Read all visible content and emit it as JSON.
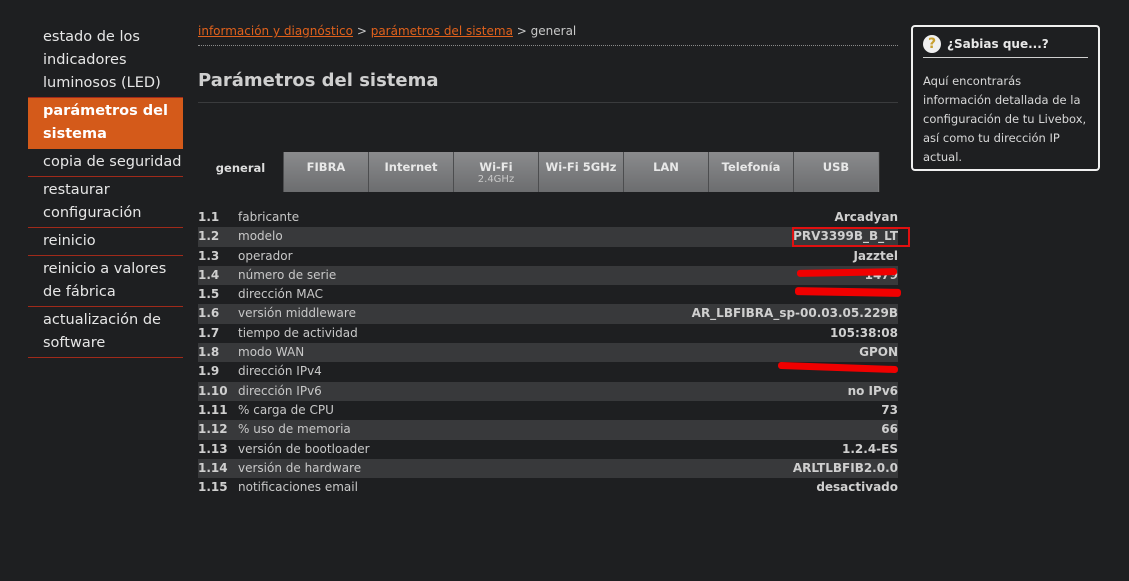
{
  "sidebar": {
    "items": [
      {
        "label": "estado de los indicadores luminosos (LED)",
        "active": false
      },
      {
        "label": "parámetros del sistema",
        "active": true
      },
      {
        "label": "copia de seguridad",
        "active": false
      },
      {
        "label": "restaurar configuración",
        "active": false
      },
      {
        "label": "reinicio",
        "active": false
      },
      {
        "label": "reinicio a valores de fábrica",
        "active": false
      },
      {
        "label": "actualización de software",
        "active": false
      }
    ]
  },
  "breadcrumb": {
    "link1": "información y diagnóstico",
    "sep": ">",
    "link2": "parámetros del sistema",
    "current": "general"
  },
  "page": {
    "title": "Parámetros del sistema"
  },
  "tabs": [
    {
      "label": "general",
      "sub": ""
    },
    {
      "label": "FIBRA",
      "sub": ""
    },
    {
      "label": "Internet",
      "sub": ""
    },
    {
      "label": "Wi-Fi",
      "sub": "2.4GHz"
    },
    {
      "label": "Wi-Fi 5GHz",
      "sub": ""
    },
    {
      "label": "LAN",
      "sub": ""
    },
    {
      "label": "Telefonía",
      "sub": ""
    },
    {
      "label": "USB",
      "sub": ""
    }
  ],
  "params": [
    {
      "num": "1.1",
      "label": "fabricante",
      "value": "Arcadyan"
    },
    {
      "num": "1.2",
      "label": "modelo",
      "value": "PRV3399B_B_LT"
    },
    {
      "num": "1.3",
      "label": "operador",
      "value": "Jazztel"
    },
    {
      "num": "1.4",
      "label": "número de serie",
      "value": "1479"
    },
    {
      "num": "1.5",
      "label": "dirección MAC",
      "value": ""
    },
    {
      "num": "1.6",
      "label": "versión middleware",
      "value": "AR_LBFIBRA_sp-00.03.05.229B"
    },
    {
      "num": "1.7",
      "label": "tiempo de actividad",
      "value": "105:38:08"
    },
    {
      "num": "1.8",
      "label": "modo WAN",
      "value": "GPON"
    },
    {
      "num": "1.9",
      "label": "dirección IPv4",
      "value": ""
    },
    {
      "num": "1.10",
      "label": "dirección IPv6",
      "value": "no IPv6"
    },
    {
      "num": "1.11",
      "label": "% carga de CPU",
      "value": "73"
    },
    {
      "num": "1.12",
      "label": "% uso de memoria",
      "value": "66"
    },
    {
      "num": "1.13",
      "label": "versión de bootloader",
      "value": "1.2.4-ES"
    },
    {
      "num": "1.14",
      "label": "versión de hardware",
      "value": "ARLTLBFIB2.0.0"
    },
    {
      "num": "1.15",
      "label": "notificaciones email",
      "value": "desactivado"
    }
  ],
  "info": {
    "title": "¿Sabias que...?",
    "text": "Aquí encontrarás información detallada de la configuración de tu Livebox, así como tu dirección IP actual.",
    "icon": "question-icon"
  },
  "colors": {
    "accent": "#d45a1a",
    "link": "#e0611c",
    "redaction": "#f00000"
  }
}
